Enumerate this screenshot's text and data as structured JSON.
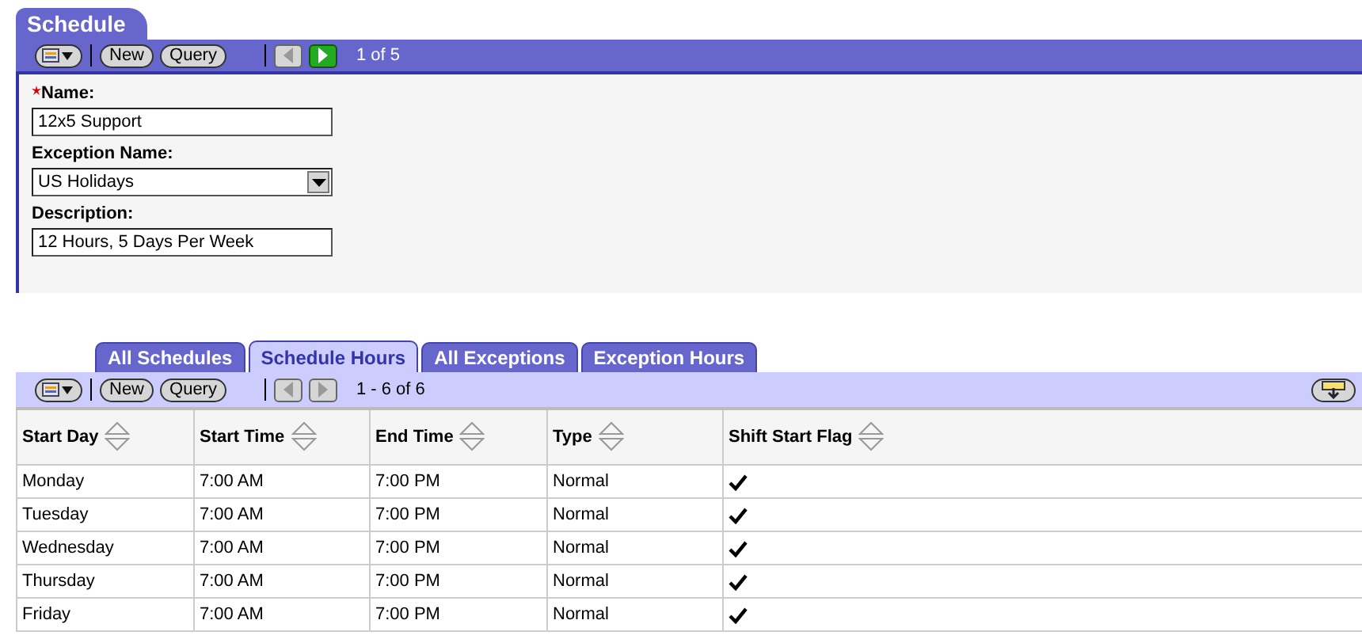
{
  "header_tab": {
    "label": "Schedule"
  },
  "top_toolbar": {
    "new_label": "New",
    "query_label": "Query",
    "prev_disabled": true,
    "next_disabled": false,
    "counter": "1 of 5"
  },
  "form": {
    "fields": [
      {
        "kind": "text",
        "label": "Name:",
        "required": true,
        "value": "12x5 Support"
      },
      {
        "kind": "select",
        "label": "Exception Name:",
        "required": false,
        "value": "US Holidays"
      },
      {
        "kind": "text",
        "label": "Description:",
        "required": false,
        "value": "12 Hours, 5 Days Per Week"
      }
    ]
  },
  "tabs": [
    {
      "label": "All Schedules",
      "selected": false
    },
    {
      "label": "Schedule Hours",
      "selected": true
    },
    {
      "label": "All Exceptions",
      "selected": false
    },
    {
      "label": "Exception Hours",
      "selected": false
    }
  ],
  "grid_toolbar": {
    "new_label": "New",
    "query_label": "Query",
    "prev_disabled": true,
    "next_disabled": true,
    "counter": "1 - 6 of 6"
  },
  "table": {
    "columns": [
      "Start Day",
      "Start Time",
      "End Time",
      "Type",
      "Shift Start Flag"
    ],
    "rows": [
      {
        "start_day": "Monday",
        "start_time": "7:00 AM",
        "end_time": "7:00 PM",
        "type": "Normal",
        "shift_start": true
      },
      {
        "start_day": "Tuesday",
        "start_time": "7:00 AM",
        "end_time": "7:00 PM",
        "type": "Normal",
        "shift_start": true
      },
      {
        "start_day": "Wednesday",
        "start_time": "7:00 AM",
        "end_time": "7:00 PM",
        "type": "Normal",
        "shift_start": true
      },
      {
        "start_day": "Thursday",
        "start_time": "7:00 AM",
        "end_time": "7:00 PM",
        "type": "Normal",
        "shift_start": true
      },
      {
        "start_day": "Friday",
        "start_time": "7:00 AM",
        "end_time": "7:00 PM",
        "type": "Normal",
        "shift_start": true
      }
    ]
  }
}
